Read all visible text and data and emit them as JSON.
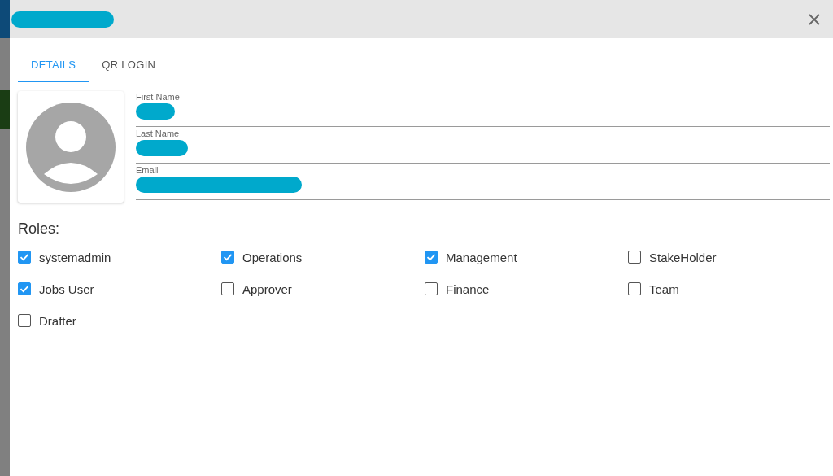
{
  "dialog": {
    "title_redacted": true
  },
  "tabs": [
    {
      "label": "DETAILS",
      "selected": true
    },
    {
      "label": "QR LOGIN",
      "selected": false
    }
  ],
  "fields": [
    {
      "label": "First Name",
      "value_redacted": true
    },
    {
      "label": "Last Name",
      "value_redacted": true
    },
    {
      "label": "Email",
      "value_redacted": true
    }
  ],
  "roles": {
    "heading": "Roles:",
    "items": [
      {
        "label": "systemadmin",
        "checked": true
      },
      {
        "label": "Operations",
        "checked": true
      },
      {
        "label": "Management",
        "checked": true
      },
      {
        "label": "StakeHolder",
        "checked": false
      },
      {
        "label": "Jobs User",
        "checked": true
      },
      {
        "label": "Approver",
        "checked": false
      },
      {
        "label": "Finance",
        "checked": false
      },
      {
        "label": "Team",
        "checked": false
      },
      {
        "label": "Drafter",
        "checked": false
      }
    ]
  }
}
